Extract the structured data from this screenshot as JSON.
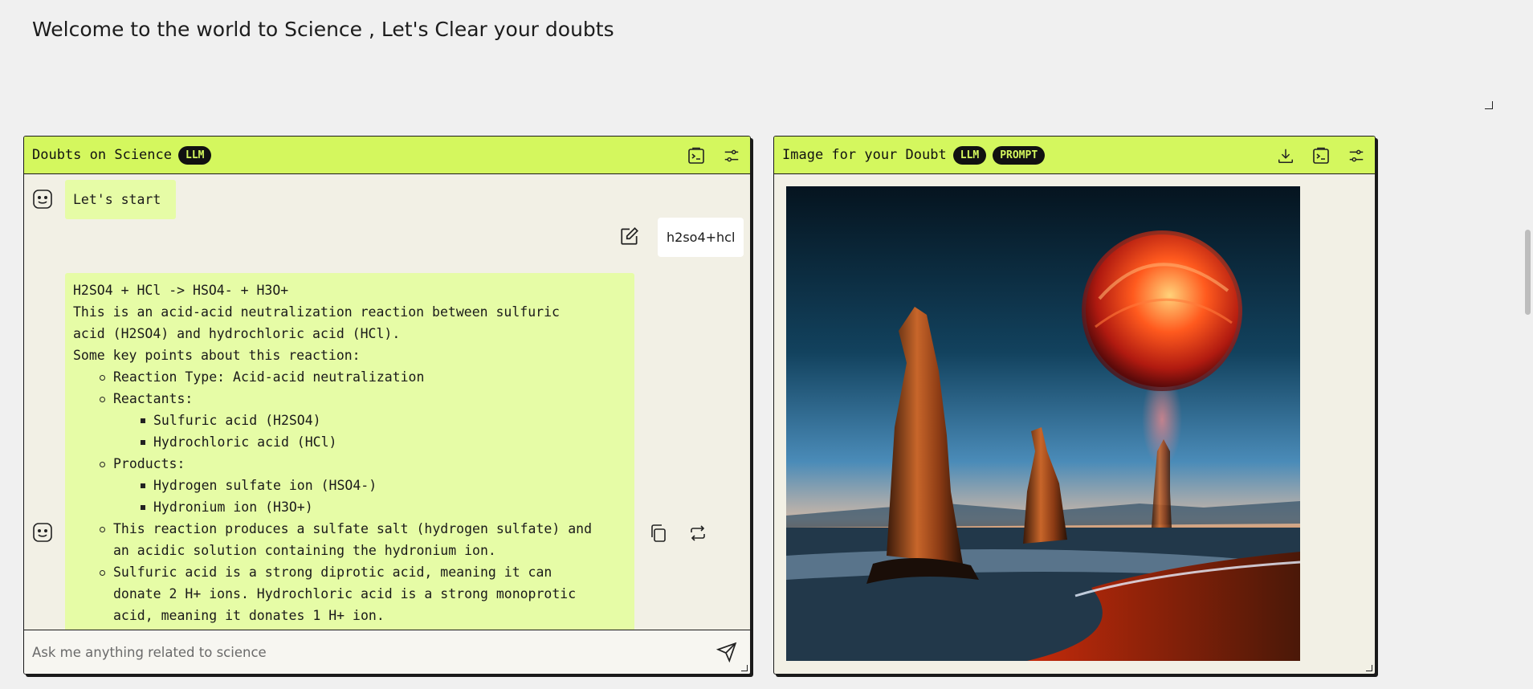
{
  "page": {
    "title": "Welcome to the world to Science , Let's Clear your doubts"
  },
  "chat_panel": {
    "title": "Doubts on Science",
    "badge": "LLM",
    "icons": [
      "copy-to-clipboard-icon",
      "settings-sliders-icon"
    ],
    "messages": [
      {
        "role": "bot",
        "text": "Let's start"
      },
      {
        "role": "user",
        "text": "h2so4+hcl"
      },
      {
        "role": "bot",
        "lines": [
          {
            "level": 0,
            "text": "H2SO4 + HCl -> HSO4- + H3O+"
          },
          {
            "level": 0,
            "text": "This is an acid-acid neutralization reaction between sulfuric"
          },
          {
            "level": 0,
            "text": "acid (H2SO4) and hydrochloric acid (HCl)."
          },
          {
            "level": 0,
            "text": "Some key points about this reaction:"
          },
          {
            "level": 1,
            "text": "Reaction Type: Acid-acid neutralization"
          },
          {
            "level": 1,
            "text": "Reactants:"
          },
          {
            "level": 2,
            "text": "Sulfuric acid (H2SO4)"
          },
          {
            "level": 2,
            "text": "Hydrochloric acid (HCl)"
          },
          {
            "level": 1,
            "text": "Products:"
          },
          {
            "level": 2,
            "text": "Hydrogen sulfate ion (HSO4-)"
          },
          {
            "level": 2,
            "text": "Hydronium ion (H3O+)"
          },
          {
            "level": 1,
            "text": "This reaction produces a sulfate salt (hydrogen sulfate) and"
          },
          {
            "level": 11,
            "text": "an acidic solution containing the hydronium ion."
          },
          {
            "level": 1,
            "text": "Sulfuric acid is a strong diprotic acid, meaning it can"
          },
          {
            "level": 11,
            "text": "donate 2 H+ ions. Hydrochloric acid is a strong monoprotic"
          },
          {
            "level": 11,
            "text": "acid, meaning it donates 1 H+ ion."
          }
        ]
      }
    ],
    "input_placeholder": "Ask me anything related to science"
  },
  "image_panel": {
    "title": "Image for your Doubt",
    "badges": [
      "LLM",
      "PROMPT"
    ],
    "icons": [
      "download-icon",
      "copy-to-clipboard-icon",
      "settings-sliders-icon"
    ]
  },
  "colors": {
    "accent": "#d4f75e",
    "bot_bubble": "#e6fca6",
    "panel_bg": "#f2f0e5",
    "page_bg": "#f0f0f0"
  }
}
